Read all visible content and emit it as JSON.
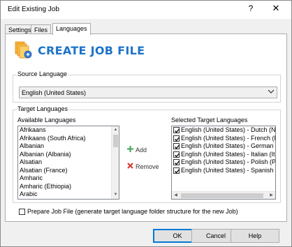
{
  "window": {
    "title": "Edit Existing Job",
    "help_label": "?",
    "close_label": "✕"
  },
  "tabs": [
    {
      "label": "Settings",
      "active": false
    },
    {
      "label": "Files",
      "active": false
    },
    {
      "label": "Languages",
      "active": true
    }
  ],
  "banner": {
    "title": "CREATE JOB FILE",
    "icon": "document-gear-icon",
    "title_color": "#1e73c8"
  },
  "source_language": {
    "legend": "Source Language",
    "selected": "English (United States)"
  },
  "target_languages": {
    "legend": "Target Languages",
    "available_label": "Available Languages",
    "available": [
      "Afrikaans",
      "Afrikaans (South Africa)",
      "Albanian",
      "Albanian (Albania)",
      "Alsatian",
      "Alsatian (France)",
      "Amharic",
      "Amharic (Ethiopia)",
      "Arabic"
    ],
    "add_label": "Add",
    "remove_label": "Remove",
    "add_color": "#3aa655",
    "remove_color": "#d9342b",
    "selected_label": "Selected Target Languages",
    "selected": [
      {
        "label": "English (United States) - Dutch (Ne",
        "checked": true
      },
      {
        "label": "English (United States) - French (F",
        "checked": true
      },
      {
        "label": "English (United States) - German (",
        "checked": true
      },
      {
        "label": "English (United States) - Italian (It",
        "checked": true
      },
      {
        "label": "English (United States) - Polish (Po",
        "checked": true
      },
      {
        "label": "English (United States) - Spanish (",
        "checked": true
      }
    ]
  },
  "prepare_job": {
    "label": "Prepare Job File (generate target language folder structure for the new Job)",
    "checked": false
  },
  "buttons": {
    "ok": "OK",
    "cancel": "Cancel",
    "help": "Help"
  }
}
